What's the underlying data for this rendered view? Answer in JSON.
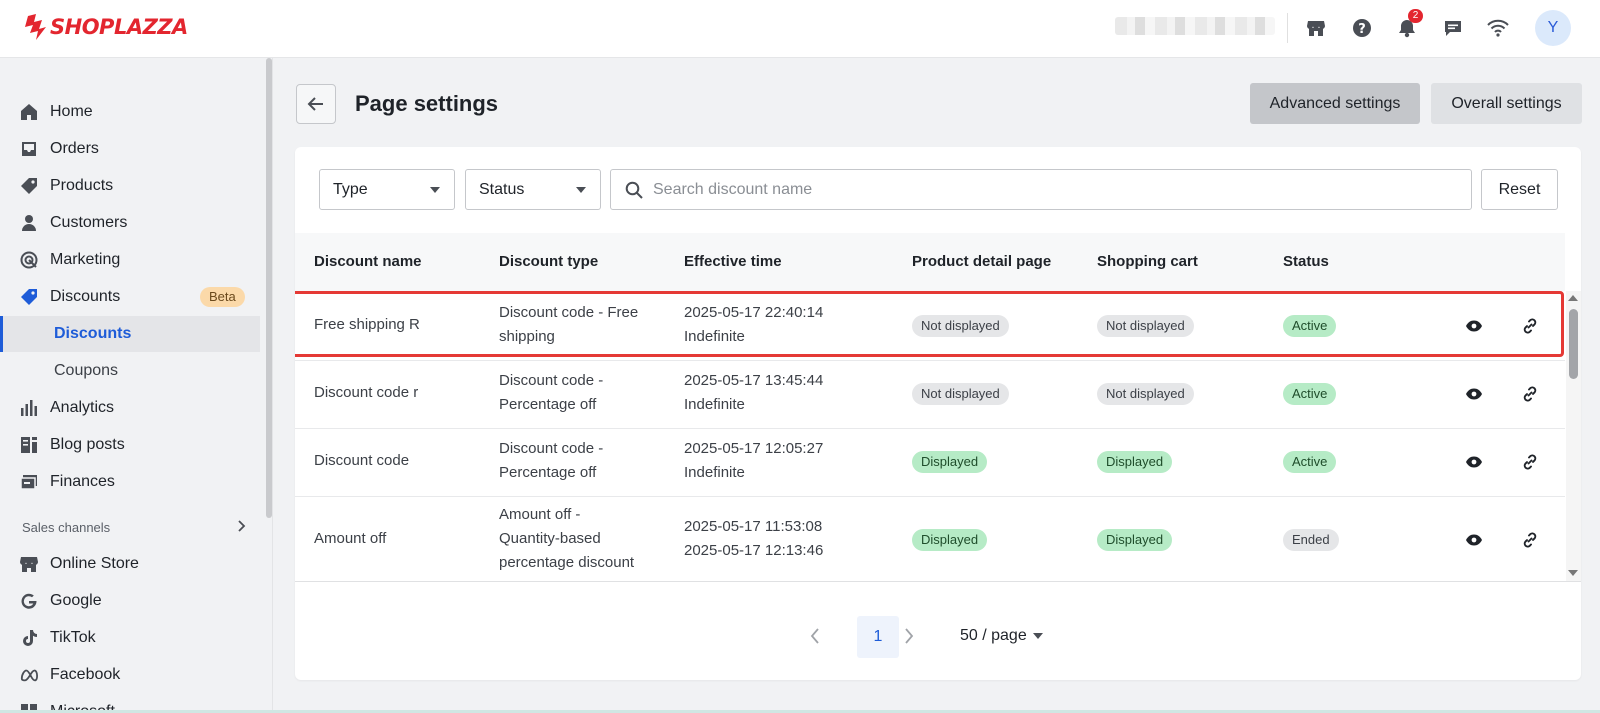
{
  "topbar": {
    "brand": "SHOPLAZZA",
    "notifications_count": "2",
    "avatar_initial": "Y"
  },
  "sidebar": {
    "items": [
      {
        "label": "Home",
        "icon": "home-icon"
      },
      {
        "label": "Orders",
        "icon": "inbox-icon"
      },
      {
        "label": "Products",
        "icon": "tag-icon"
      },
      {
        "label": "Customers",
        "icon": "person-icon"
      },
      {
        "label": "Marketing",
        "icon": "target-icon"
      },
      {
        "label": "Discounts",
        "icon": "discount-tag-icon",
        "badge": "Beta"
      },
      {
        "label": "Analytics",
        "icon": "bar-chart-icon"
      },
      {
        "label": "Blog posts",
        "icon": "blog-icon"
      },
      {
        "label": "Finances",
        "icon": "finance-icon"
      }
    ],
    "sub_items": [
      {
        "label": "Discounts",
        "active": true
      },
      {
        "label": "Coupons",
        "active": false
      }
    ],
    "section_label": "Sales channels",
    "channels": [
      {
        "label": "Online Store",
        "icon": "store-icon"
      },
      {
        "label": "Google",
        "icon": "google-icon"
      },
      {
        "label": "TikTok",
        "icon": "tiktok-icon"
      },
      {
        "label": "Facebook",
        "icon": "meta-icon"
      },
      {
        "label": "Microsoft",
        "icon": "microsoft-icon"
      }
    ]
  },
  "header": {
    "title": "Page settings",
    "advanced_label": "Advanced settings",
    "overall_label": "Overall settings"
  },
  "filters": {
    "type_label": "Type",
    "status_label": "Status",
    "search_placeholder": "Search discount name",
    "reset_label": "Reset"
  },
  "table": {
    "columns": [
      "Discount name",
      "Discount type",
      "Effective time",
      "Product detail page",
      "Shopping cart",
      "Status"
    ],
    "rows": [
      {
        "name": "Free shipping R",
        "type_lines": [
          "Discount code - Free",
          "shipping"
        ],
        "time_lines": [
          "2025-05-17 22:40:14",
          "Indefinite"
        ],
        "pdp": "Not displayed",
        "cart": "Not displayed",
        "status": "Active"
      },
      {
        "name": "Discount code r",
        "type_lines": [
          "Discount code -",
          "Percentage off"
        ],
        "time_lines": [
          "2025-05-17 13:45:44",
          "Indefinite"
        ],
        "pdp": "Not displayed",
        "cart": "Not displayed",
        "status": "Active"
      },
      {
        "name": "Discount code",
        "type_lines": [
          "Discount code -",
          "Percentage off"
        ],
        "time_lines": [
          "2025-05-17 12:05:27",
          "Indefinite"
        ],
        "pdp": "Displayed",
        "cart": "Displayed",
        "status": "Active"
      },
      {
        "name": "Amount off",
        "type_lines": [
          "Amount off -",
          "Quantity-based",
          "percentage discount"
        ],
        "time_lines": [
          "2025-05-17 11:53:08",
          "2025-05-17 12:13:46"
        ],
        "pdp": "Displayed",
        "cart": "Displayed",
        "status": "Ended"
      }
    ]
  },
  "pagination": {
    "current_page": "1",
    "page_size": "50 / page"
  },
  "colors": {
    "brand_red": "#e3262f",
    "accent_blue": "#1e5cd8",
    "pill_green": "#b6ebc6",
    "highlight_red": "#e53935"
  }
}
